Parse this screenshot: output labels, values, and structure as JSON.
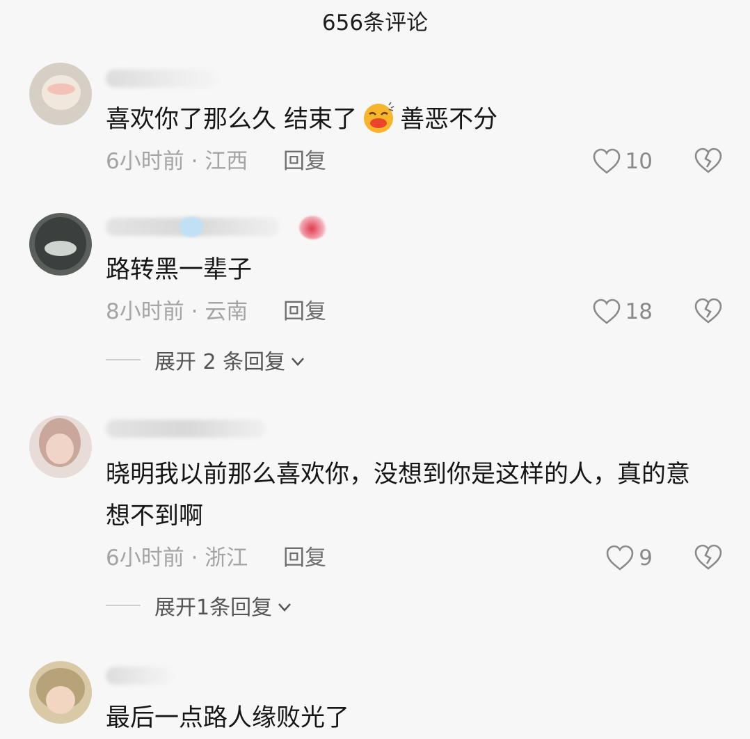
{
  "header": {
    "title": "656条评论"
  },
  "comments": [
    {
      "text_before": "喜欢你了那么久 结束了",
      "emoji": "crying-laughing-emoji",
      "text_after": "善恶不分",
      "meta": "6小时前 · 江西",
      "reply": "回复",
      "likes": "10"
    },
    {
      "text": "路转黑一辈子",
      "meta": "8小时前 · 云南",
      "reply": "回复",
      "likes": "18",
      "expand": "展开 2 条回复"
    },
    {
      "text": "晓明我以前那么喜欢你，没想到你是这样的人，真的意想不到啊",
      "meta": "6小时前 · 浙江",
      "reply": "回复",
      "likes": "9",
      "expand": "展开1条回复"
    },
    {
      "text": "最后一点路人缘败光了"
    }
  ],
  "colors": {
    "background": "#f7f7f7",
    "meta": "#a4a4a4",
    "text": "#161616"
  }
}
